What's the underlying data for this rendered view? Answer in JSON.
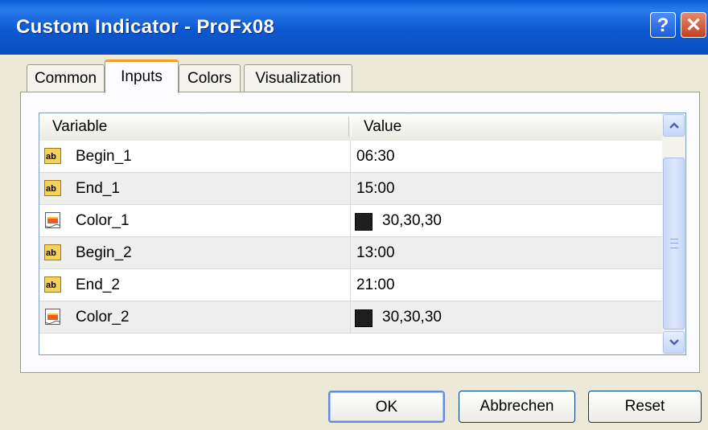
{
  "window": {
    "title": "Custom Indicator - ProFx08",
    "help_glyph": "?",
    "close_glyph": "✕"
  },
  "tabs": [
    {
      "label": "Common",
      "active": false
    },
    {
      "label": "Inputs",
      "active": true
    },
    {
      "label": "Colors",
      "active": false
    },
    {
      "label": "Visualization",
      "active": false
    }
  ],
  "table": {
    "headers": {
      "variable": "Variable",
      "value": "Value"
    },
    "rows": [
      {
        "name": "Begin_1",
        "value": "06:30",
        "icon": "ab-string-icon"
      },
      {
        "name": "End_1",
        "value": "15:00",
        "icon": "ab-string-icon"
      },
      {
        "name": "Color_1",
        "value": "30,30,30",
        "icon": "color-param-icon",
        "swatch": "#1e1e1e"
      },
      {
        "name": "Begin_2",
        "value": "13:00",
        "icon": "ab-string-icon"
      },
      {
        "name": "End_2",
        "value": "21:00",
        "icon": "ab-string-icon"
      },
      {
        "name": "Color_2",
        "value": "30,30,30",
        "icon": "color-param-icon",
        "swatch": "#1e1e1e"
      }
    ]
  },
  "buttons": {
    "ok": "OK",
    "cancel": "Abbrechen",
    "reset": "Reset"
  },
  "colors": {
    "titlebar": "#0a5fd8",
    "active_tab_accent": "#f0a030"
  }
}
